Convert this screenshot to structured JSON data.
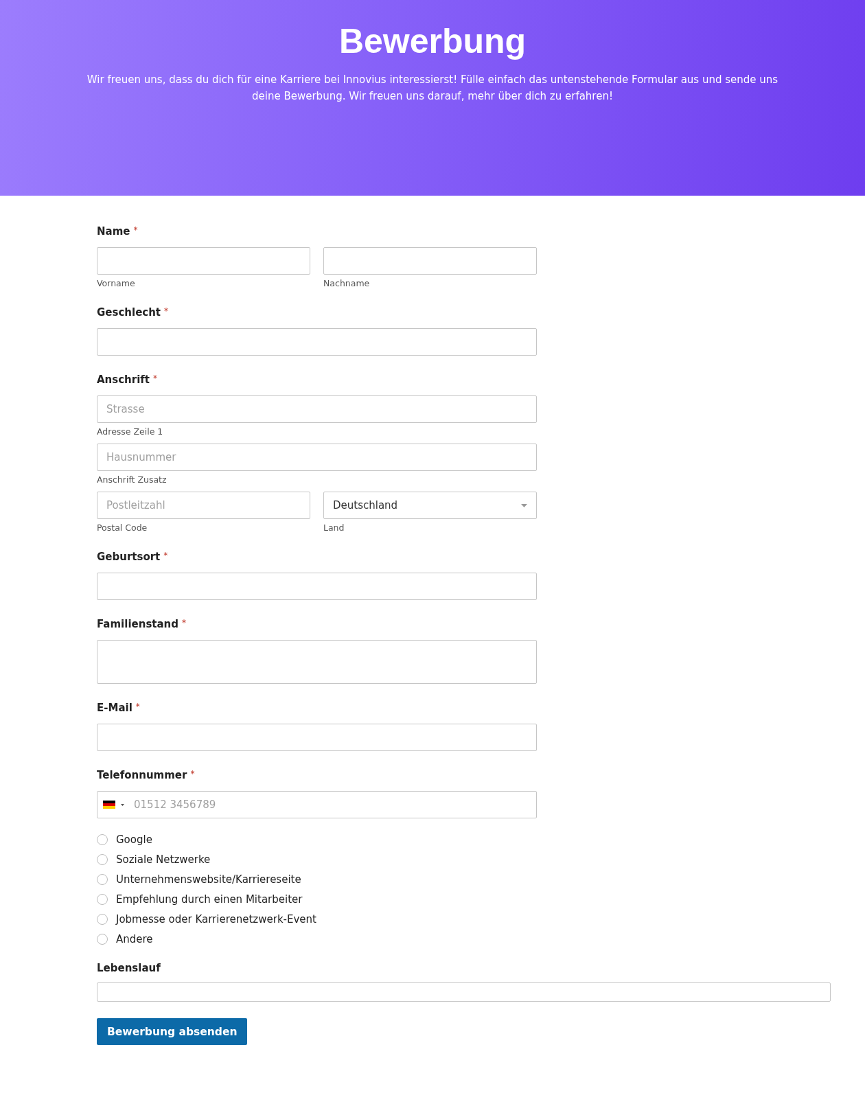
{
  "header": {
    "title": "Bewerbung",
    "intro": "Wir freuen uns, dass du dich für eine Karriere bei Innovius interessierst! Fülle einfach das untenstehende Formular aus und sende uns deine Bewerbung. Wir freuen uns darauf, mehr über dich zu erfahren!"
  },
  "sections": [
    {
      "label": "Name",
      "required_mark": "*",
      "rows": [
        [
          {
            "kind": "text",
            "caption": "Vorname"
          },
          {
            "kind": "text",
            "caption": "Nachname"
          }
        ]
      ]
    },
    {
      "label": "Geschlecht",
      "required_mark": "*",
      "rows": [
        [
          {
            "kind": "text"
          }
        ]
      ]
    },
    {
      "label": "Anschrift",
      "required_mark": "*",
      "rows": [
        [
          {
            "kind": "text",
            "placeholder": "Strasse",
            "caption": "Adresse Zeile 1"
          }
        ],
        [
          {
            "kind": "text",
            "placeholder": "Hausnummer",
            "caption": "Anschrift Zusatz"
          }
        ],
        [
          {
            "kind": "text",
            "placeholder": "Postleitzahl",
            "caption": "Postal Code"
          },
          {
            "kind": "select",
            "value": "Deutschland",
            "caption": "Land"
          }
        ]
      ]
    },
    {
      "label": "Geburtsort",
      "required_mark": "*",
      "rows": [
        [
          {
            "kind": "text"
          }
        ]
      ]
    },
    {
      "label": "Familienstand",
      "required_mark": "*",
      "rows": [
        [
          {
            "kind": "textarea"
          }
        ]
      ]
    },
    {
      "label": "E-Mail",
      "required_mark": "*",
      "rows": [
        [
          {
            "kind": "text"
          }
        ]
      ]
    },
    {
      "label": "Telefonnummer",
      "required_mark": "*",
      "rows": [
        [
          {
            "kind": "phone",
            "placeholder": "01512 3456789"
          }
        ]
      ]
    }
  ],
  "sources": [
    {
      "label": "Google",
      "selected": false
    },
    {
      "label": "Soziale Netzwerke",
      "selected": false
    },
    {
      "label": "Unternehmenswebsite/Karriereseite",
      "selected": false
    },
    {
      "label": "Empfehlung durch einen Mitarbeiter",
      "selected": false
    },
    {
      "label": "Jobmesse oder Karrierenetzwerk-Event",
      "selected": false
    },
    {
      "label": "Andere",
      "selected": false
    }
  ],
  "upload": {
    "label": "Lebenslauf"
  },
  "submit": {
    "label": "Bewerbung absenden"
  }
}
